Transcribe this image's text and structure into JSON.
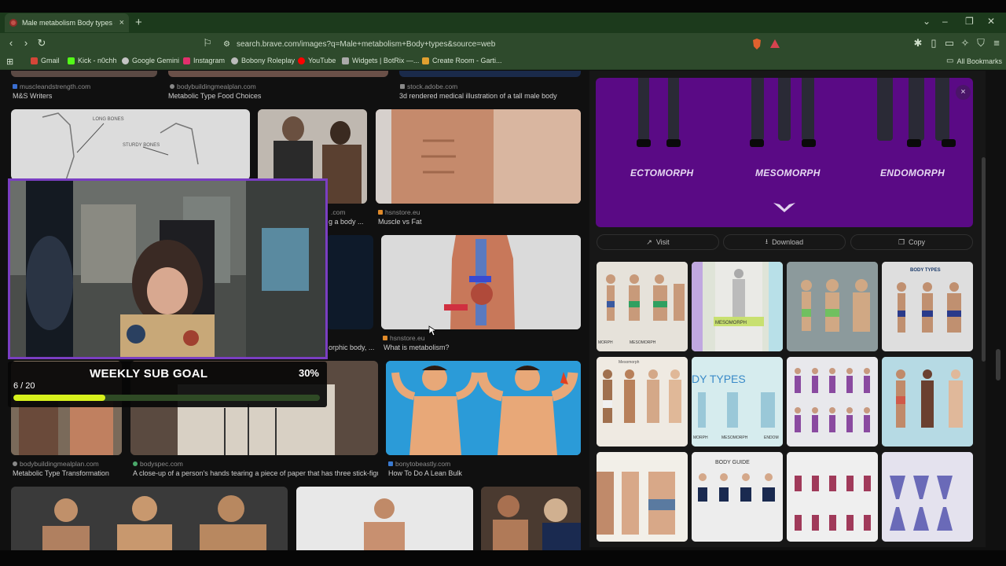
{
  "browser": {
    "tab_title": "Male metabolism Body types - B",
    "new_tab": "+",
    "url": "search.brave.com/images?q=Male+metabolism+Body+types&source=web",
    "bookmarks": [
      "Gmail",
      "Kick - n0chh",
      "Google Gemini",
      "Instagram",
      "Bobony Roleplay",
      "YouTube",
      "Widgets | BotRix —...",
      "Create Room - Garti..."
    ],
    "all_bookmarks": "All Bookmarks"
  },
  "results": {
    "row0": [
      {
        "source": "muscleandstrength.com",
        "caption": "M&S Writers"
      },
      {
        "source": "bodybuildingmealplan.com",
        "caption": "Metabolic Type Food Choices"
      },
      {
        "source": "stock.adobe.com",
        "caption": "3d rendered medical illustration of a tall male body"
      }
    ],
    "row1": [
      {
        "source": "hsnstore.eu",
        "caption": "Muscle vs Fat"
      },
      {
        "source": ".com",
        "caption": "g a body ..."
      }
    ],
    "row2": [
      {
        "source": "hsnstore.eu",
        "caption": "What is metabolism?"
      },
      {
        "source": "",
        "caption": "orphic body, ..."
      }
    ],
    "row3": [
      {
        "source": "bodybuildingmealplan.com",
        "caption": "Metabolic Type Transformation"
      },
      {
        "source": "bodyspec.com",
        "caption": "A close-up of a person's hands tearing a piece of paper that has three stick-figu..."
      },
      {
        "source": "bonytobeastly.com",
        "caption": "How To Do A Lean Bulk"
      }
    ],
    "bones_labels": [
      "LONG BONES",
      "STURDY BONES"
    ]
  },
  "detail": {
    "hero_labels": [
      "ECTOMORPH",
      "MESOMORPH",
      "ENDOMORPH"
    ],
    "close": "×",
    "visit": "Visit",
    "download": "Download",
    "copy": "Copy",
    "grid_text": {
      "a": "MORPH",
      "a2": "MESOMORPH",
      "b": "MESOMORPH",
      "d": "BODY TYPES",
      "e": "Mesomorph",
      "f": "DY TYPES",
      "f2": "MESOMORPH",
      "g": "ENDOM",
      "k": "BODY GUIDE"
    }
  },
  "overlay": {
    "title": "WEEKLY SUB GOAL",
    "percent": "30%",
    "count": "6 / 20",
    "progress": 0.3
  }
}
